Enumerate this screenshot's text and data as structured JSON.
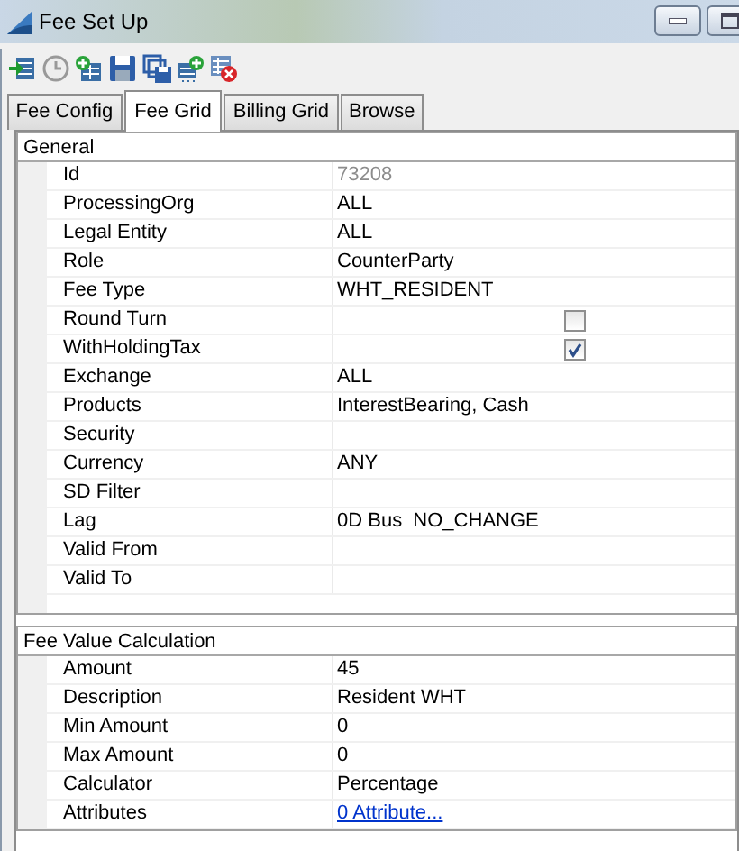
{
  "window": {
    "title": "Fee Set Up"
  },
  "toolbar": {
    "buttons": [
      {
        "kind": "import"
      },
      {
        "kind": "clock"
      },
      {
        "kind": "add-table"
      },
      {
        "kind": "save"
      },
      {
        "kind": "save-all"
      },
      {
        "kind": "add-row"
      },
      {
        "kind": "delete-table"
      }
    ]
  },
  "tabs": [
    {
      "label": "Fee Config",
      "selected": false
    },
    {
      "label": "Fee Grid",
      "selected": true
    },
    {
      "label": "Billing Grid",
      "selected": false
    },
    {
      "label": "Browse",
      "selected": false
    }
  ],
  "sections": [
    {
      "title": "General",
      "rows": [
        {
          "label": "Id",
          "kind": "readonly",
          "value": "73208"
        },
        {
          "label": "ProcessingOrg",
          "kind": "text",
          "value": "ALL"
        },
        {
          "label": "Legal Entity",
          "kind": "text",
          "value": "ALL"
        },
        {
          "label": "Role",
          "kind": "text",
          "value": "CounterParty"
        },
        {
          "label": "Fee Type",
          "kind": "text",
          "value": "WHT_RESIDENT"
        },
        {
          "label": "Round Turn",
          "kind": "checkbox",
          "checked": false
        },
        {
          "label": "WithHoldingTax",
          "kind": "checkbox",
          "checked": true
        },
        {
          "label": "Exchange",
          "kind": "text",
          "value": "ALL"
        },
        {
          "label": "Products",
          "kind": "text",
          "value": "InterestBearing, Cash"
        },
        {
          "label": "Security",
          "kind": "text"
        },
        {
          "label": "Currency",
          "kind": "text",
          "value": "ANY"
        },
        {
          "label": "SD Filter",
          "kind": "text"
        },
        {
          "label": "Lag",
          "kind": "text",
          "value": "0D Bus  NO_CHANGE"
        },
        {
          "label": "Valid From",
          "kind": "text"
        },
        {
          "label": "Valid To",
          "kind": "text"
        }
      ]
    },
    {
      "title": "Fee Value Calculation",
      "rows": [
        {
          "label": "Amount",
          "kind": "text",
          "value": "45"
        },
        {
          "label": "Description",
          "kind": "text",
          "value": "Resident WHT"
        },
        {
          "label": "Min Amount",
          "kind": "text",
          "value": "0"
        },
        {
          "label": "Max Amount",
          "kind": "text",
          "value": "0"
        },
        {
          "label": "Calculator",
          "kind": "text",
          "value": "Percentage"
        },
        {
          "label": "Attributes",
          "kind": "link",
          "value": "0 Attribute..."
        }
      ]
    }
  ]
}
